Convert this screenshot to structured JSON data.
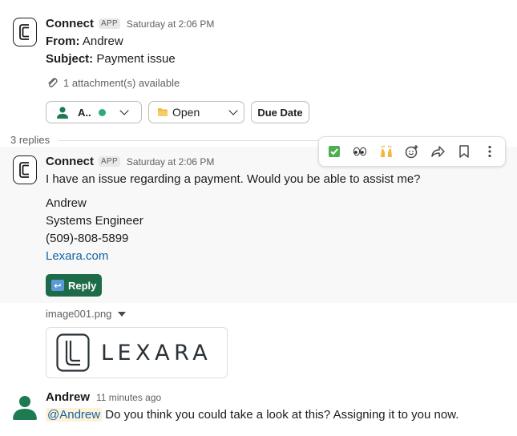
{
  "msg1": {
    "sender": "Connect",
    "badge": "APP",
    "timestamp": "Saturday at 2:06 PM",
    "from_label": "From:",
    "from_value": "Andrew",
    "subject_label": "Subject:",
    "subject_value": "Payment issue",
    "attachments": "1 attachment(s) available",
    "assignee_abbrev": "A..",
    "status_value": "Open",
    "due_date_label": "Due Date"
  },
  "thread": {
    "replies_count": "3 replies"
  },
  "toolbar": {
    "icons": [
      "white-check-mark",
      "eyes",
      "raised-hands",
      "add-reaction",
      "forward",
      "bookmark",
      "more-vertical"
    ]
  },
  "msg2": {
    "sender": "Connect",
    "badge": "APP",
    "timestamp": "Saturday at 2:06 PM",
    "body": "I have an issue regarding a payment. Would you be able to assist me?",
    "signature": [
      "Andrew",
      "Systems Engineer",
      "(509)-808-5899"
    ],
    "link": "Lexara.com",
    "reply_label": "Reply",
    "filename": "image001.png",
    "logo_word": "LEXARA"
  },
  "msg3": {
    "sender": "Andrew",
    "timestamp": "11 minutes ago",
    "mention": "@Andrew",
    "body": " Do you think you could take a look at this? Assigning it to you now."
  },
  "colors": {
    "reply_button": "#1e6b4a",
    "link": "#1264a3",
    "presence_green": "#2bac76",
    "avatar_green": "#1d7a51",
    "mention_bg": "#fdf1d8"
  }
}
